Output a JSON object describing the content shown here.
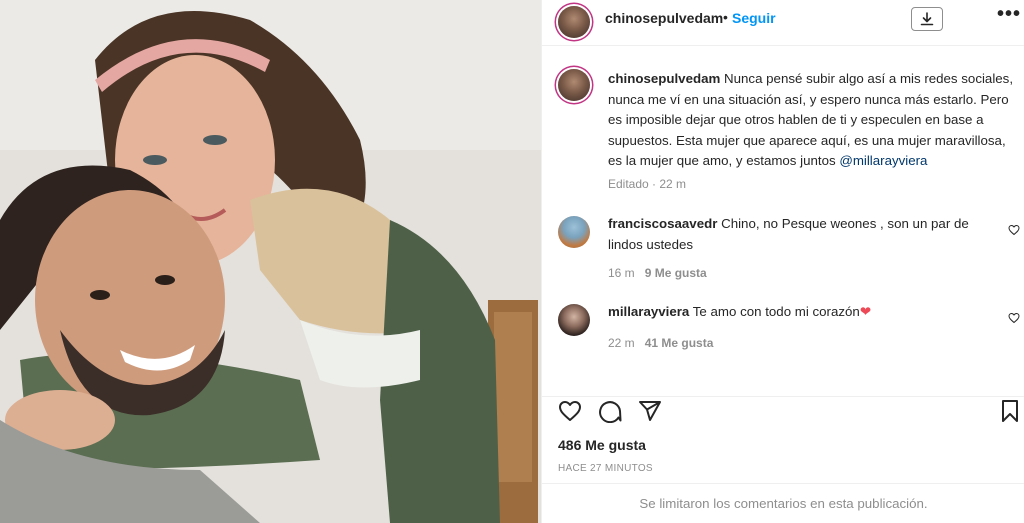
{
  "post": {
    "username": "chinosepulvedam",
    "separator": "•",
    "follow_label": "Seguir",
    "more_label": "•••"
  },
  "caption": {
    "username": "chinosepulvedam",
    "text": " Nunca pensé subir algo así a mis redes sociales, nunca me ví en una situación así, y espero nunca más estarlo. Pero es imposible dejar que otros hablen de ti y especulen en base a supuestos. Esta mujer que aparece aquí, es una mujer maravillosa, es la mujer que amo, y estamos juntos ",
    "mention": "@millarayviera",
    "meta": "Editado · 22 m"
  },
  "comments": [
    {
      "username": "franciscosaavedr",
      "text": " Chino, no Pesque weones , son un par de lindos ustedes",
      "time": "16 m",
      "likes": "9 Me gusta"
    },
    {
      "username": "millarayviera",
      "text": " Te amo con todo mi corazón",
      "emoji": "❤",
      "time": "22 m",
      "likes": "41 Me gusta"
    }
  ],
  "engagement": {
    "likes": "486 Me gusta",
    "time_ago": "HACE 27 MINUTOS"
  },
  "footer": {
    "limited_comments": "Se limitaron los comentarios en esta publicación."
  },
  "icons": {
    "download": "download-icon",
    "like": "heart-icon",
    "comment": "comment-icon",
    "share": "share-icon",
    "save": "bookmark-icon"
  },
  "colors": {
    "accent": "#0095f6",
    "mention": "#00376b",
    "muted": "#8e8e8e",
    "heart": "#ed4956"
  }
}
